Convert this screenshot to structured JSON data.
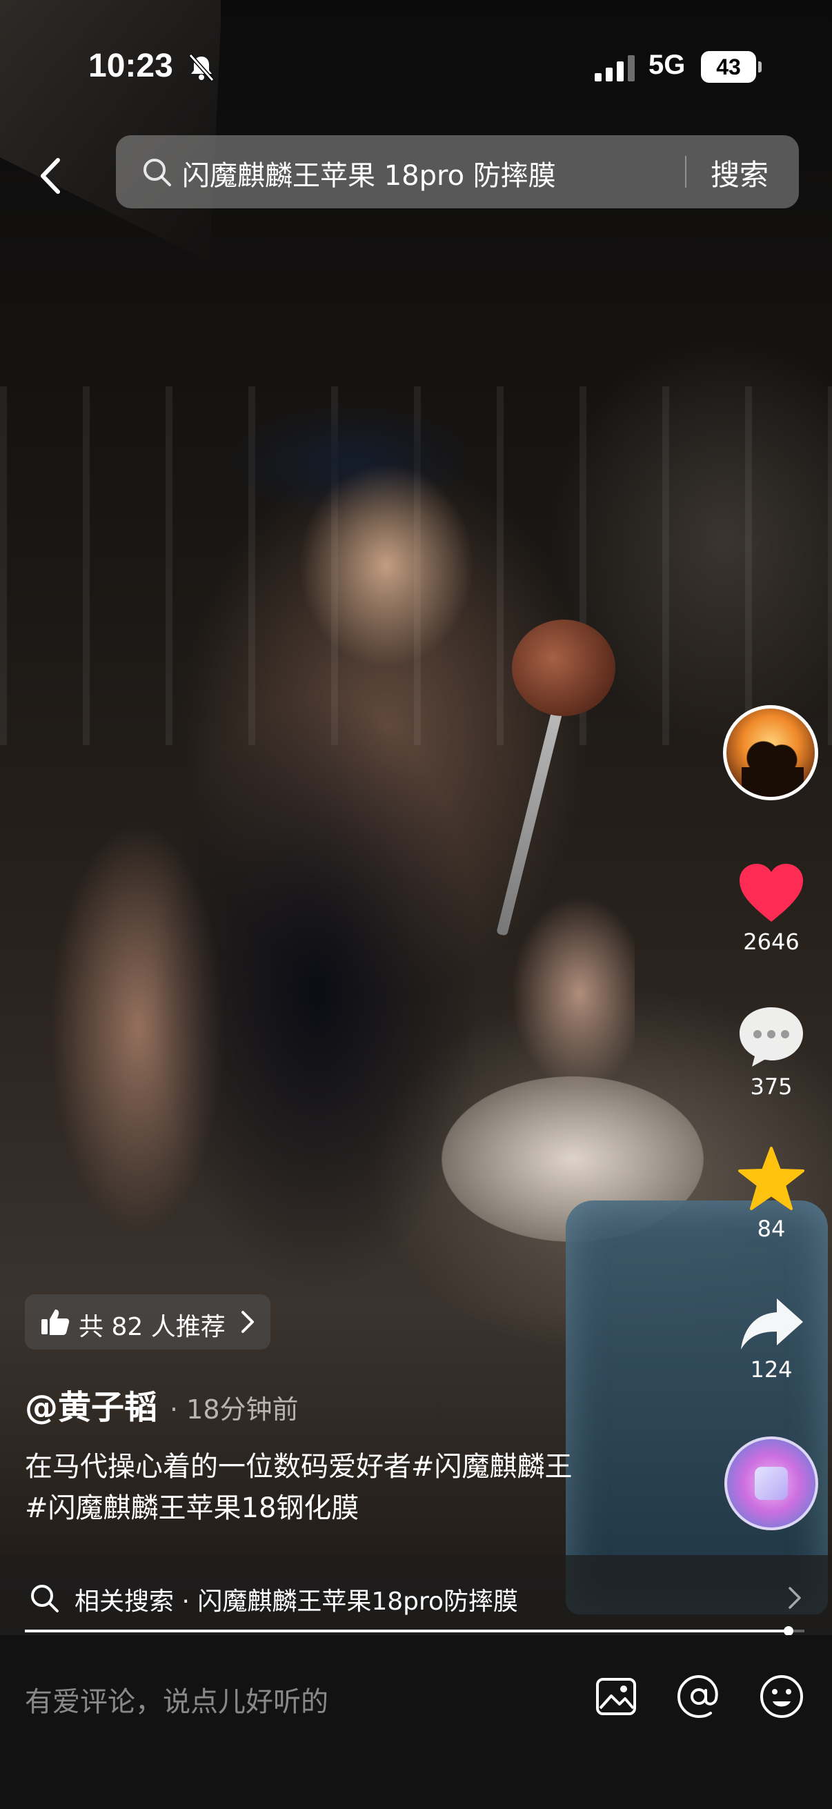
{
  "status_bar": {
    "time": "10:23",
    "network": "5G",
    "battery": "43"
  },
  "search": {
    "query": "闪魔麒麟王苹果 18pro 防摔膜",
    "button_label": "搜索"
  },
  "actions": {
    "likes": "2646",
    "comments": "375",
    "favorites": "84",
    "shares": "124"
  },
  "recommend": {
    "label": "共 82 人推荐"
  },
  "post": {
    "author": "@黄子韬",
    "time": "· 18分钟前",
    "caption_line1": "在马代操心着的一位数码爱好者#闪魔麒麟王",
    "caption_line2": "#闪魔麒麟王苹果18钢化膜"
  },
  "related_search": {
    "label": "相关搜索 · 闪魔麒麟王苹果18pro防摔膜"
  },
  "playback": {
    "progress": 0.98
  },
  "comment_bar": {
    "placeholder": "有爱评论，说点儿好听的"
  },
  "colors": {
    "like_red": "#fe2c55",
    "favorite_yellow": "#ffc20e",
    "comment_bar_bg": "#121212"
  },
  "icons": [
    "bell-muted-icon",
    "signal-icon",
    "battery-icon",
    "back-icon",
    "search-icon",
    "heart-icon",
    "comment-icon",
    "star-icon",
    "share-icon",
    "thumb-up-icon",
    "chevron-right-icon",
    "image-icon",
    "at-icon",
    "emoji-icon"
  ]
}
